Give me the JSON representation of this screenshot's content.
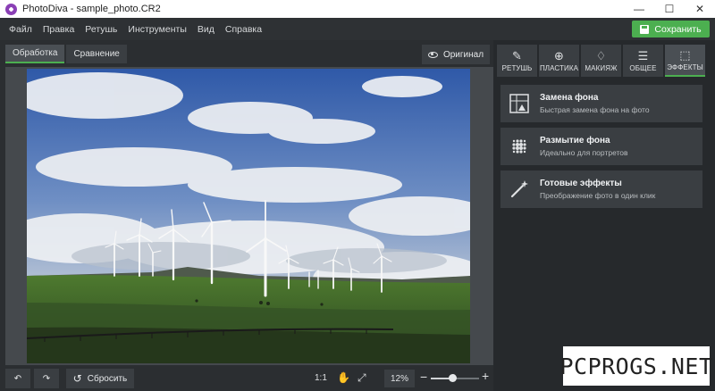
{
  "window": {
    "title": "PhotoDiva - sample_photo.CR2",
    "controls": {
      "minimize": "—",
      "maximize": "☐",
      "close": "✕"
    }
  },
  "menu": [
    "Файл",
    "Правка",
    "Ретушь",
    "Инструменты",
    "Вид",
    "Справка"
  ],
  "save_button": "Сохранить",
  "view_tabs": [
    "Обработка",
    "Сравнение"
  ],
  "original_button": "Оригинал",
  "bottom_toolbar": {
    "reset_label": "Сбросить",
    "ratio": "1:1",
    "zoom": "12%",
    "zoom_slider_value": 0.45
  },
  "right_tabs": [
    {
      "label": "РЕТУШЬ",
      "icon": "retouch-icon"
    },
    {
      "label": "ПЛАСТИКА",
      "icon": "liquify-icon"
    },
    {
      "label": "МАКИЯЖ",
      "icon": "makeup-icon"
    },
    {
      "label": "ОБЩЕЕ",
      "icon": "adjustments-icon"
    },
    {
      "label": "ЭФФЕКТЫ",
      "icon": "effects-icon",
      "active": true
    }
  ],
  "effects": [
    {
      "title": "Замена фона",
      "desc": "Быстрая замена фона на фото",
      "icon": "background-replace-icon"
    },
    {
      "title": "Размытие фона",
      "desc": "Идеально для портретов",
      "icon": "blur-icon"
    },
    {
      "title": "Готовые эффекты",
      "desc": "Преображение фото в один клик",
      "icon": "magic-wand-icon"
    }
  ],
  "watermark": "PCPROGS.NET",
  "colors": {
    "accent": "#4caf50",
    "panel": "#3a3e42",
    "background": "#2b2e31"
  }
}
